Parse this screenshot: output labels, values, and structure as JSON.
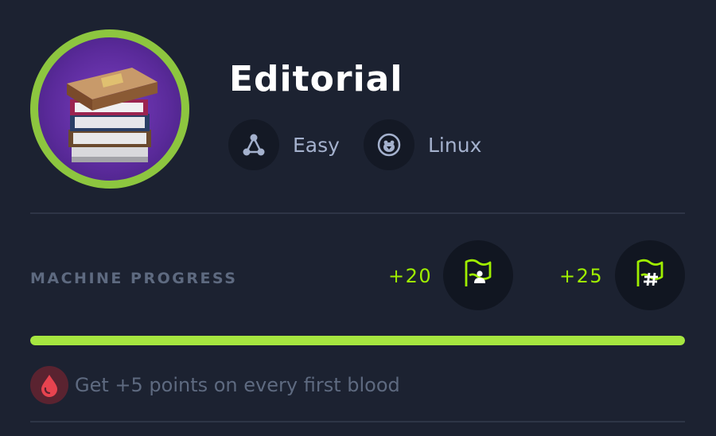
{
  "machine": {
    "name": "Editorial",
    "difficulty": "Easy",
    "os": "Linux",
    "ring_color": "#8dc63f"
  },
  "progress": {
    "label": "MACHINE PROGRESS",
    "user_flag_points": "+20",
    "root_flag_points": "+25",
    "fill_fraction": 1.0,
    "accent_color": "#9fef00"
  },
  "first_blood": {
    "text": "Get +5 points on every first blood",
    "color": "#e8434f"
  },
  "icons": {
    "difficulty": "difficulty-icon",
    "os": "linux-penguin-icon",
    "user_flag": "user-flag-icon",
    "root_flag": "root-flag-icon",
    "blood": "blood-drop-icon"
  }
}
